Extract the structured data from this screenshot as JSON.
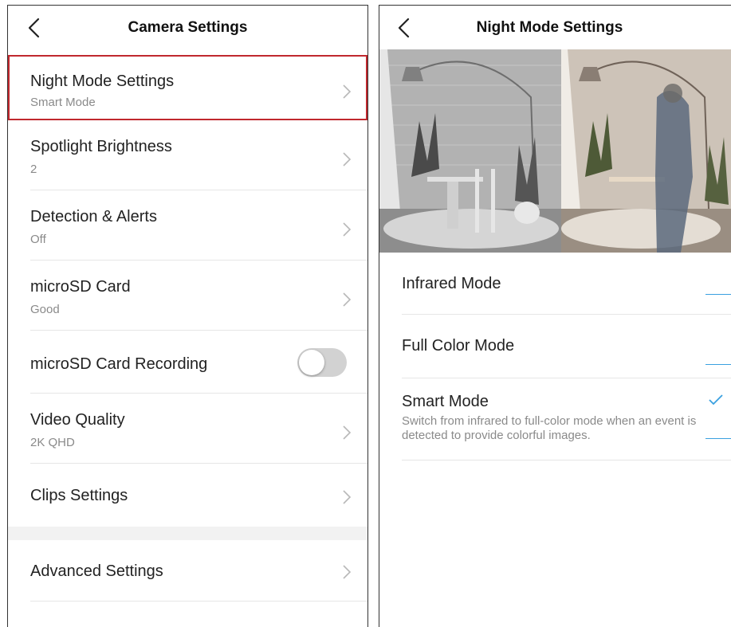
{
  "left": {
    "title": "Camera Settings",
    "items": [
      {
        "title": "Night Mode Settings",
        "subtitle": "Smart Mode"
      },
      {
        "title": "Spotlight Brightness",
        "subtitle": "2"
      },
      {
        "title": "Detection & Alerts",
        "subtitle": "Off"
      },
      {
        "title": "microSD Card",
        "subtitle": "Good"
      },
      {
        "title": "microSD Card Recording",
        "toggle_on": false
      },
      {
        "title": "Video Quality",
        "subtitle": "2K QHD"
      },
      {
        "title": "Clips Settings"
      },
      {
        "title": "Advanced Settings"
      }
    ]
  },
  "right": {
    "title": "Night Mode Settings",
    "options": [
      {
        "title": "Infrared Mode",
        "selected": false
      },
      {
        "title": "Full Color Mode",
        "selected": false
      },
      {
        "title": "Smart Mode",
        "description": "Switch from infrared to full-color mode when an event is detected to provide colorful images.",
        "selected": true
      }
    ]
  },
  "colors": {
    "highlight_border": "#c0282e",
    "accent": "#3aa0e0",
    "toggle_off": "#d2d2d2"
  }
}
